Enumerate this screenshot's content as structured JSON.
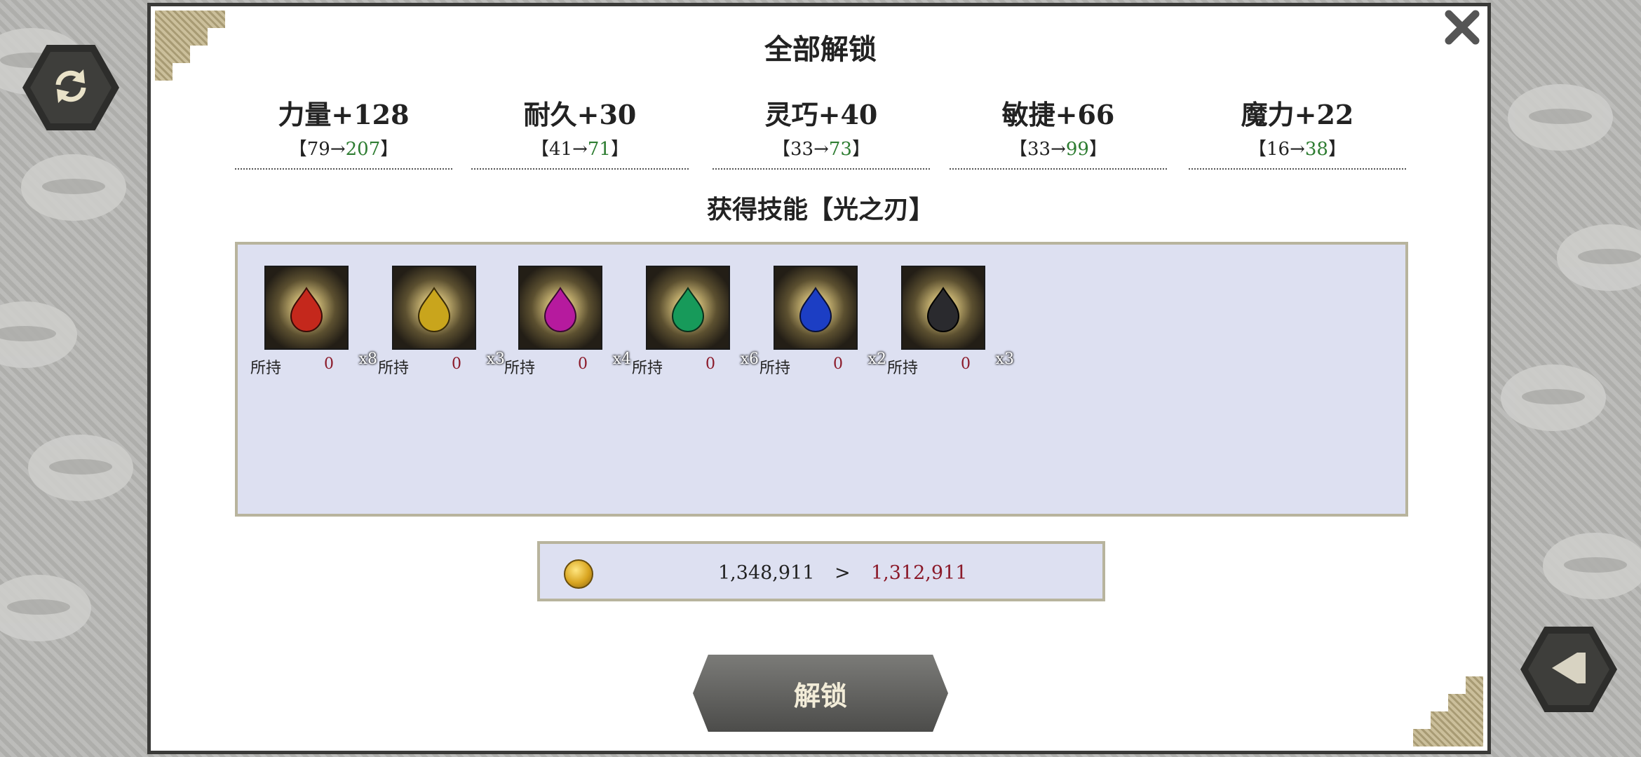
{
  "dialog": {
    "title": "全部解锁",
    "skill_text": "获得技能【光之刃】"
  },
  "stats": [
    {
      "name": "力量+128",
      "open": "【79→",
      "new": "207",
      "close": "】"
    },
    {
      "name": "耐久+30",
      "open": "【41→",
      "new": "71",
      "close": "】"
    },
    {
      "name": "灵巧+40",
      "open": "【33→",
      "new": "73",
      "close": "】"
    },
    {
      "name": "敏捷+66",
      "open": "【33→",
      "new": "99",
      "close": "】"
    },
    {
      "name": "魔力+22",
      "open": "【16→",
      "new": "38",
      "close": "】"
    }
  ],
  "items": [
    {
      "gem": "red-gem-icon",
      "color": "#c4281c",
      "qty": "x8",
      "own_label": "所持",
      "own_value": "0"
    },
    {
      "gem": "yellow-gem-icon",
      "color": "#c9a51c",
      "qty": "x3",
      "own_label": "所持",
      "own_value": "0"
    },
    {
      "gem": "magenta-gem-icon",
      "color": "#b61a9e",
      "qty": "x4",
      "own_label": "所持",
      "own_value": "0"
    },
    {
      "gem": "green-gem-icon",
      "color": "#179a5a",
      "qty": "x6",
      "own_label": "所持",
      "own_value": "0"
    },
    {
      "gem": "blue-gem-icon",
      "color": "#1c3ec4",
      "qty": "x2",
      "own_label": "所持",
      "own_value": "0"
    },
    {
      "gem": "black-gem-icon",
      "color": "#2a2a2e",
      "qty": "x3",
      "own_label": "所持",
      "own_value": "0"
    }
  ],
  "cost": {
    "current": "1,348,911",
    "arrow": ">",
    "after": "1,312,911"
  },
  "buttons": {
    "unlock": "解锁"
  },
  "colors": {
    "stat_new": "#2e7d32",
    "owned_value": "#8b1a2a",
    "panel_bg": "#dde0f1"
  }
}
